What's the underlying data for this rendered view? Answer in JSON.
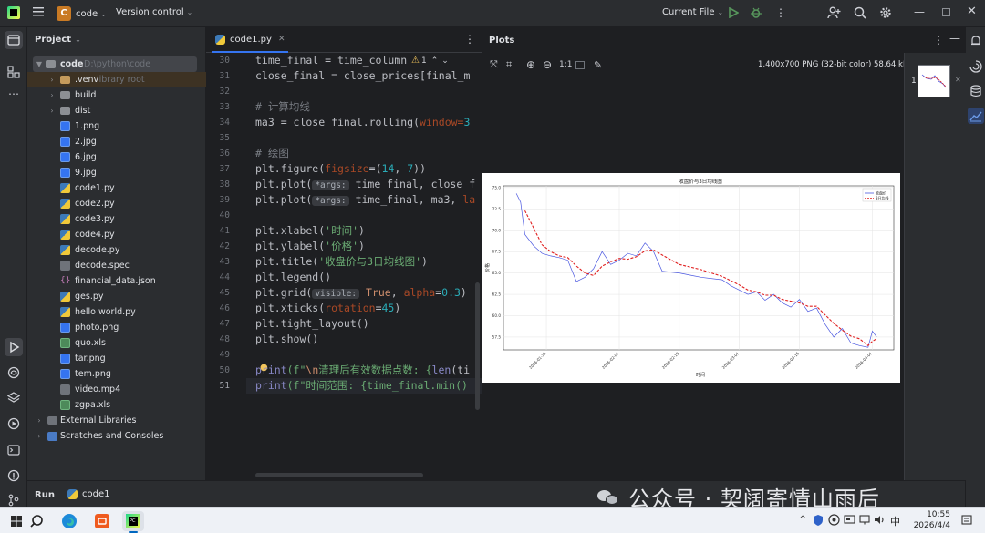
{
  "titlebar": {
    "project_badge": "C",
    "project_name": "code",
    "vcs": "Version control",
    "run_config": "Current File"
  },
  "project_panel": {
    "title": "Project",
    "root_name": "code",
    "root_path": "D:\\python\\code",
    "items": [
      {
        "label": "code",
        "hint": "D:\\python\\code"
      },
      {
        "label": ".venv",
        "hint": "library root"
      },
      {
        "label": "build",
        "hint": ""
      },
      {
        "label": "dist",
        "hint": ""
      },
      {
        "label": "1.png",
        "hint": ""
      },
      {
        "label": "2.jpg",
        "hint": ""
      },
      {
        "label": "6.jpg",
        "hint": ""
      },
      {
        "label": "9.jpg",
        "hint": ""
      },
      {
        "label": "code1.py",
        "hint": ""
      },
      {
        "label": "code2.py",
        "hint": ""
      },
      {
        "label": "code3.py",
        "hint": ""
      },
      {
        "label": "code4.py",
        "hint": ""
      },
      {
        "label": "decode.py",
        "hint": ""
      },
      {
        "label": "decode.spec",
        "hint": ""
      },
      {
        "label": "financial_data.json",
        "hint": ""
      },
      {
        "label": "ges.py",
        "hint": ""
      },
      {
        "label": "hello world.py",
        "hint": ""
      },
      {
        "label": "photo.png",
        "hint": ""
      },
      {
        "label": "quo.xls",
        "hint": ""
      },
      {
        "label": "tar.png",
        "hint": ""
      },
      {
        "label": "tem.png",
        "hint": ""
      },
      {
        "label": "video.mp4",
        "hint": ""
      },
      {
        "label": "zgpa.xls",
        "hint": ""
      },
      {
        "label": "External Libraries",
        "hint": ""
      },
      {
        "label": "Scratches and Consoles",
        "hint": ""
      }
    ]
  },
  "editor": {
    "tab_name": "code1.py",
    "warning_count": "1",
    "line_numbers": [
      "30",
      "31",
      "32",
      "33",
      "34",
      "35",
      "36",
      "37",
      "38",
      "39",
      "40",
      "41",
      "42",
      "43",
      "44",
      "45",
      "46",
      "47",
      "48",
      "49",
      "50",
      "51"
    ],
    "lines": {
      "l30": "time_final = time_column[f",
      "l31": "close_final = close_prices[final_m",
      "l33": "# 计算均线",
      "l34a": "ma3 = close_final.rolling(",
      "l34b": "window=",
      "l34c": "3",
      "l36": "# 绘图",
      "l37a": "plt.figure(",
      "l37b": "figsize",
      "l37c": "=(",
      "l37d": "14",
      "l37e": ", ",
      "l37f": "7",
      "l37g": "))",
      "l38a": "plt.plot(",
      "hint_args": "*args:",
      "l38b": " time_final, close_f",
      "l39a": "plt.plot(",
      "l39b": " time_final, ma3, ",
      "l39c": "la",
      "l41a": "plt.xlabel(",
      "l41b": "'时间'",
      "l41c": ")",
      "l42a": "plt.ylabel(",
      "l42b": "'价格'",
      "l42c": ")",
      "l43a": "plt.title(",
      "l43b": "'收盘价与3日均线图'",
      "l43c": ")",
      "l44": "plt.legend()",
      "l45a": "plt.grid(",
      "hint_visible": "visible:",
      "l45b": " ",
      "l45c": "True",
      "l45d": ", ",
      "l45e": "alpha",
      "l45f": "=",
      "l45g": "0.3",
      "l45h": ")",
      "l46a": "plt.xticks(",
      "l46b": "rotation",
      "l46c": "=",
      "l46d": "45",
      "l46e": ")",
      "l47": "plt.tight_layout()",
      "l48": "plt.show()",
      "l50a": "print",
      "l50b": "(f\"",
      "l50c": "\\n",
      "l50d": "清理后有效数据点数: {",
      "l50e": "len",
      "l50f": "(ti",
      "l51a": "print",
      "l51b": "(f\"时间范围: {time_final.min()"
    }
  },
  "plots": {
    "title": "Plots",
    "scale_label": "1:1",
    "image_info": "1,400x700 PNG (32-bit color) 58.64 kB",
    "thumb_number": "1"
  },
  "run": {
    "label": "Run",
    "tab": "code1"
  },
  "watermark": "公众号 · 契阔寄情山雨后",
  "taskbar": {
    "time": "10:55",
    "date": "2026/4/4",
    "ime": "中"
  },
  "chart_data": {
    "type": "line",
    "title": "收盘价与3日均线图",
    "xlabel": "时间",
    "ylabel": "价格",
    "x_ticks": [
      "2026-01-15",
      "2026-02-01",
      "2026-02-15",
      "2026-03-01",
      "2026-03-15",
      "2026-04-01"
    ],
    "y_ticks": [
      57.5,
      60.0,
      62.5,
      65.0,
      67.5,
      70.0,
      72.5,
      75.0
    ],
    "ylim": [
      56.0,
      75.2
    ],
    "legend_placement": "top-right",
    "grid": true,
    "series": [
      {
        "name": "收盘价",
        "color": "#4a57e0",
        "style": "solid",
        "x": [
          "2026-01-08",
          "2026-01-09",
          "2026-01-10",
          "2026-01-12",
          "2026-01-14",
          "2026-01-16",
          "2026-01-18",
          "2026-01-20",
          "2026-01-22",
          "2026-01-24",
          "2026-01-26",
          "2026-01-28",
          "2026-01-30",
          "2026-02-01",
          "2026-02-03",
          "2026-02-05",
          "2026-02-07",
          "2026-02-09",
          "2026-02-11",
          "2026-02-15",
          "2026-02-20",
          "2026-02-25",
          "2026-02-27",
          "2026-03-01",
          "2026-03-03",
          "2026-03-05",
          "2026-03-07",
          "2026-03-09",
          "2026-03-11",
          "2026-03-13",
          "2026-03-15",
          "2026-03-17",
          "2026-03-19",
          "2026-03-21",
          "2026-03-23",
          "2026-03-25",
          "2026-03-27",
          "2026-03-29",
          "2026-03-31",
          "2026-04-01",
          "2026-04-02"
        ],
        "values": [
          74.3,
          73.3,
          69.5,
          68.2,
          67.3,
          67.0,
          66.8,
          66.5,
          64.0,
          64.5,
          65.5,
          67.5,
          66.0,
          66.5,
          67.3,
          67.0,
          68.5,
          67.5,
          65.2,
          65.0,
          64.5,
          64.2,
          63.5,
          63.0,
          62.5,
          62.8,
          61.8,
          62.5,
          61.5,
          61.0,
          61.9,
          60.5,
          60.9,
          59.0,
          57.5,
          58.5,
          56.8,
          56.5,
          56.3,
          58.2,
          57.5
        ]
      },
      {
        "name": "3日均线",
        "color": "#e02020",
        "style": "dashed",
        "x": [
          "2026-01-10",
          "2026-01-12",
          "2026-01-14",
          "2026-01-16",
          "2026-01-18",
          "2026-01-20",
          "2026-01-22",
          "2026-01-24",
          "2026-01-26",
          "2026-01-28",
          "2026-01-30",
          "2026-02-01",
          "2026-02-03",
          "2026-02-05",
          "2026-02-07",
          "2026-02-09",
          "2026-02-11",
          "2026-02-15",
          "2026-02-20",
          "2026-02-25",
          "2026-02-27",
          "2026-03-01",
          "2026-03-03",
          "2026-03-05",
          "2026-03-07",
          "2026-03-09",
          "2026-03-11",
          "2026-03-13",
          "2026-03-15",
          "2026-03-17",
          "2026-03-19",
          "2026-03-21",
          "2026-03-23",
          "2026-03-25",
          "2026-03-27",
          "2026-03-29",
          "2026-03-31",
          "2026-04-01",
          "2026-04-02"
        ],
        "values": [
          72.3,
          70.3,
          68.3,
          67.5,
          67.0,
          66.8,
          65.8,
          65.0,
          64.7,
          65.8,
          66.3,
          66.7,
          66.6,
          66.9,
          67.6,
          67.7,
          67.1,
          66.0,
          65.4,
          64.6,
          64.1,
          63.6,
          63.0,
          62.8,
          62.4,
          62.4,
          61.9,
          61.7,
          61.5,
          61.1,
          61.1,
          60.1,
          59.1,
          58.3,
          57.6,
          57.3,
          56.5,
          57.0,
          57.3
        ]
      }
    ]
  }
}
